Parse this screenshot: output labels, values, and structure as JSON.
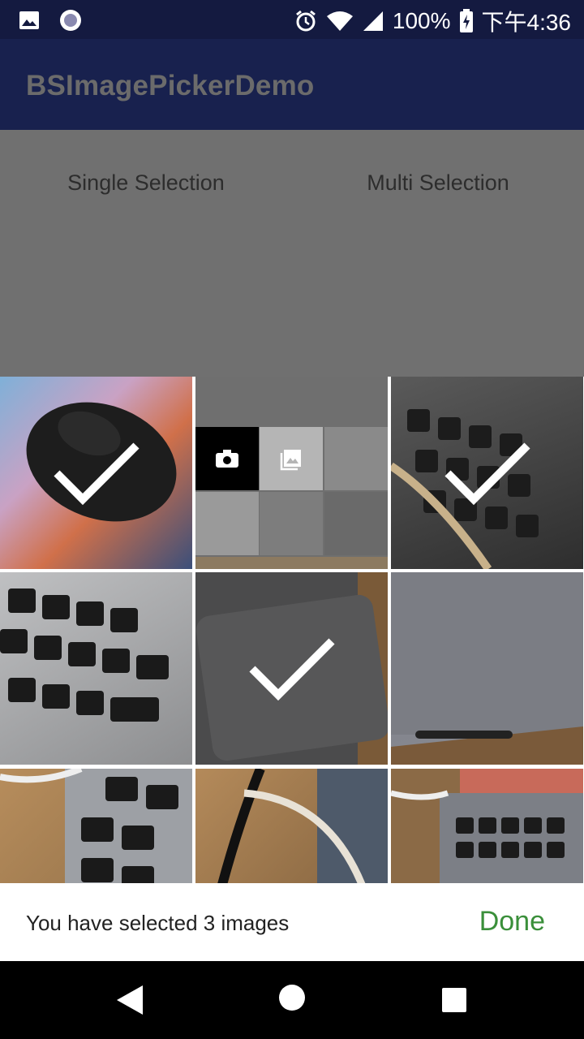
{
  "status_bar": {
    "battery_text": "100%",
    "time": "下午4:36"
  },
  "app_bar": {
    "title": "BSImagePickerDemo"
  },
  "buttons": {
    "single": "Single Selection",
    "multi": "Multi Selection"
  },
  "picker": {
    "selected_count_text": "You have selected 3 images",
    "done_label": "Done",
    "tiles": [
      {
        "name": "photo-mouse",
        "selected": true
      },
      {
        "name": "album-tile",
        "selected": false
      },
      {
        "name": "photo-keyboard-1",
        "selected": true
      },
      {
        "name": "photo-keyboard-2",
        "selected": false
      },
      {
        "name": "photo-trackpad-1",
        "selected": true
      },
      {
        "name": "photo-trackpad-2",
        "selected": false
      },
      {
        "name": "photo-keyboard-3",
        "selected": false
      },
      {
        "name": "photo-cable",
        "selected": false
      },
      {
        "name": "photo-laptop",
        "selected": false
      }
    ]
  },
  "colors": {
    "status_bar": "#141a40",
    "app_bar": "#18214e",
    "accent_done": "#3a8f3a"
  }
}
